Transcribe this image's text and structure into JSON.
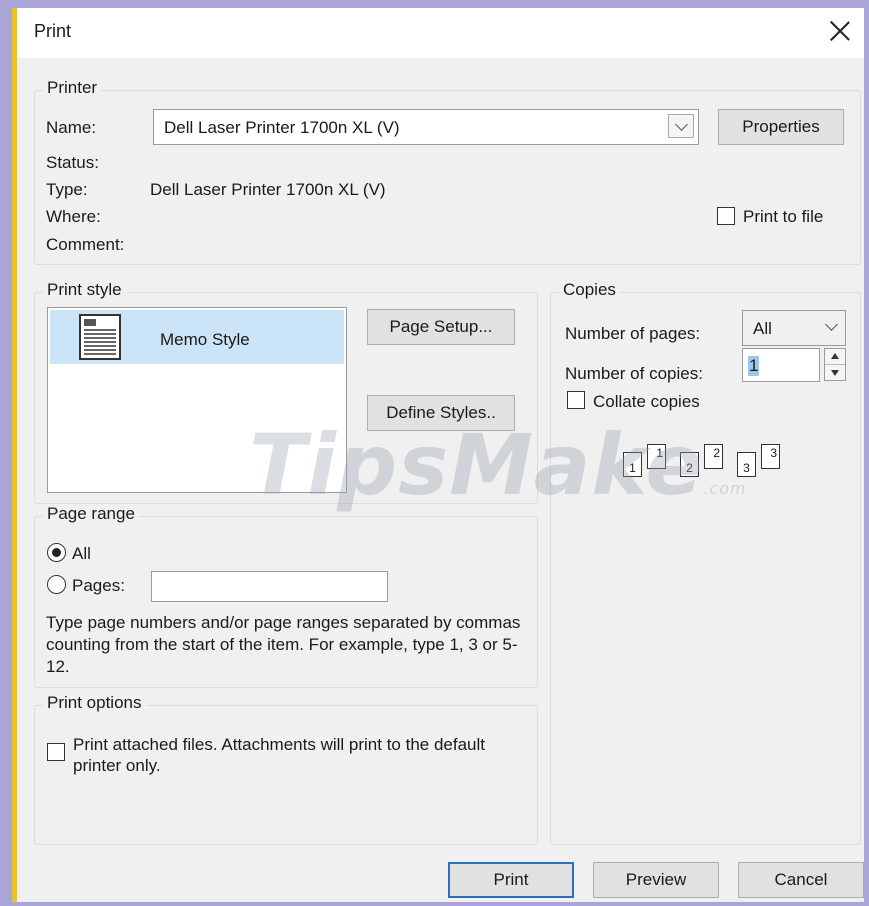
{
  "window": {
    "title": "Print"
  },
  "printer": {
    "legend": "Printer",
    "name_label": "Name:",
    "name_value": "Dell Laser Printer 1700n XL (V)",
    "properties_label": "Properties",
    "status_label": "Status:",
    "type_label": "Type:",
    "type_value": "Dell Laser Printer 1700n XL (V)",
    "where_label": "Where:",
    "comment_label": "Comment:",
    "print_to_file_label": "Print to file",
    "print_to_file_checked": false
  },
  "print_style": {
    "legend": "Print style",
    "items": [
      {
        "label": "Memo Style",
        "selected": true
      }
    ],
    "page_setup_label": "Page Setup...",
    "define_styles_label": "Define Styles.."
  },
  "copies": {
    "legend": "Copies",
    "number_of_pages_label": "Number of pages:",
    "number_of_pages_value": "All",
    "number_of_copies_label": "Number of copies:",
    "number_of_copies_value": "1",
    "collate_label": "Collate copies",
    "collate_checked": false,
    "collate_pages": [
      "1",
      "1",
      "2",
      "2",
      "3",
      "3"
    ]
  },
  "page_range": {
    "legend": "Page range",
    "all_label": "All",
    "pages_label": "Pages:",
    "pages_value": "",
    "help_text": "Type page numbers and/or page ranges separated by commas counting from the start of the item.  For example, type 1, 3 or 5-12.",
    "selected": "all"
  },
  "print_options": {
    "legend": "Print options",
    "attached_label": "Print attached files.  Attachments will print to the default printer only.",
    "attached_checked": false
  },
  "buttons": {
    "print": "Print",
    "preview": "Preview",
    "cancel": "Cancel"
  },
  "watermark": {
    "brand": "TipsMake",
    "suffix": ".com"
  },
  "colors": {
    "title_bg": "#ffffff",
    "dialog_bg": "#f0f0f0",
    "accent_border": "#e7c42a",
    "selection": "#cce4f7",
    "default_button_border": "#2b6fc0",
    "outer_bg": "#a9a5d6"
  }
}
